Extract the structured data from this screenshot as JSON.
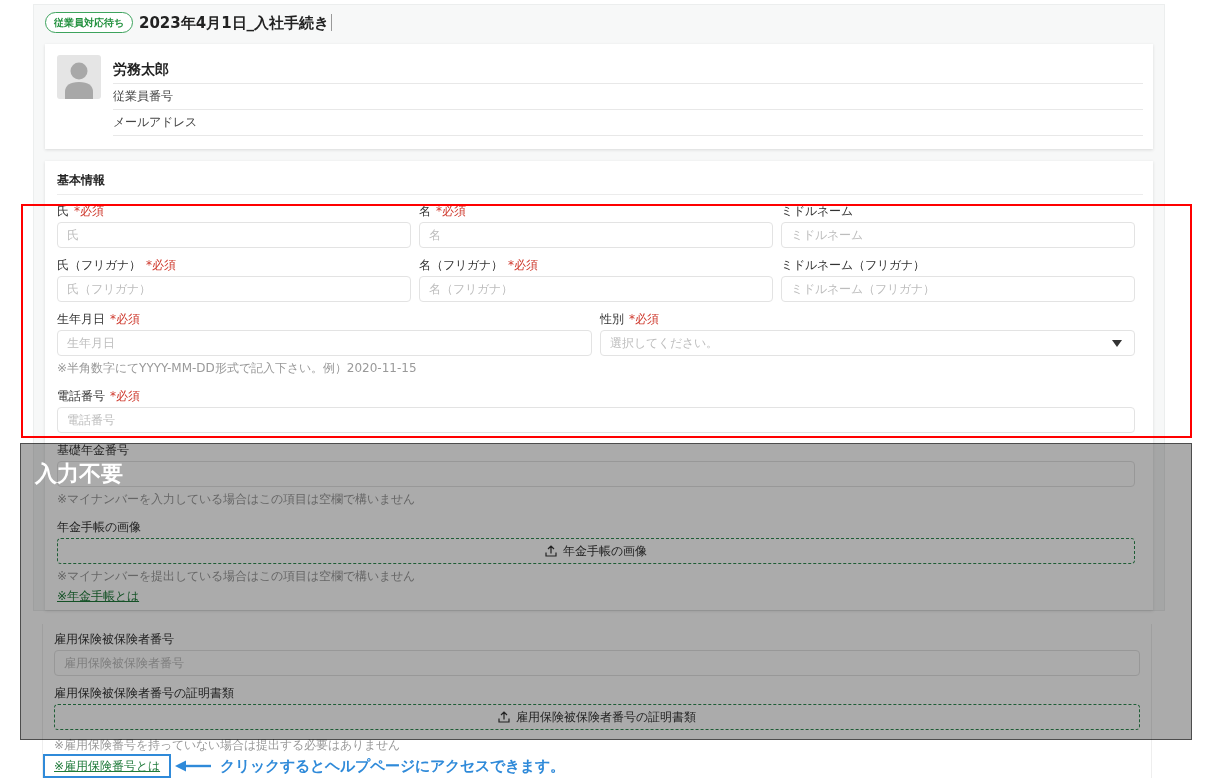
{
  "header": {
    "status_badge": "従業員対応待ち",
    "title": "2023年4月1日_入社手続き",
    "title_focused": true
  },
  "profile": {
    "name": "労務太郎",
    "fields": [
      "従業員番号",
      "メールアドレス"
    ]
  },
  "basic_info": {
    "title": "基本情報",
    "rows": [
      {
        "fields": [
          {
            "kind": "text",
            "label": "氏",
            "required_mark": "*必須",
            "placeholder": "氏"
          },
          {
            "kind": "text",
            "label": "名",
            "required_mark": "*必須",
            "placeholder": "名"
          },
          {
            "kind": "text",
            "label": "ミドルネーム",
            "placeholder": "ミドルネーム"
          }
        ]
      },
      {
        "fields": [
          {
            "kind": "text",
            "label": "氏（フリガナ）",
            "required_mark": "*必須",
            "placeholder": "氏（フリガナ）"
          },
          {
            "kind": "text",
            "label": "名（フリガナ）",
            "required_mark": "*必須",
            "placeholder": "名（フリガナ）"
          },
          {
            "kind": "text",
            "label": "ミドルネーム（フリガナ）",
            "placeholder": "ミドルネーム（フリガナ）"
          }
        ]
      },
      {
        "fields": [
          {
            "kind": "text",
            "label": "生年月日",
            "required_mark": "*必須",
            "placeholder": "生年月日",
            "hint": "※半角数字にてYYYY-MM-DD形式で記入下さい。例）2020-11-15"
          },
          {
            "kind": "select",
            "label": "性別",
            "required_mark": "*必須",
            "placeholder": "選択してください。"
          }
        ]
      },
      {
        "fields": [
          {
            "kind": "text",
            "label": "電話番号",
            "required_mark": "*必須",
            "placeholder": "電話番号"
          }
        ]
      },
      {
        "fields": [
          {
            "kind": "text",
            "label": "基礎年金番号",
            "hint": "※マイナンバーを入力している場合はこの項目は空欄で構いません"
          }
        ]
      },
      {
        "fields": [
          {
            "kind": "upload",
            "label": "年金手帳の画像",
            "button": "年金手帳の画像",
            "hint": "※マイナンバーを提出している場合はこの項目は空欄で構いません",
            "link": "※年金手帳とは"
          }
        ]
      }
    ]
  },
  "employment_insurance": {
    "rows": [
      {
        "fields": [
          {
            "kind": "text",
            "label": "雇用保険被保険者番号",
            "placeholder": "雇用保険被保険者番号"
          }
        ]
      },
      {
        "fields": [
          {
            "kind": "upload",
            "label": "雇用保険被保険者番号の証明書類",
            "button": "雇用保険被保険者番号の証明書類",
            "hint": "※雇用保険番号を持っていない場合は提出する必要はありません",
            "link": "※雇用保険番号とは"
          }
        ]
      }
    ]
  },
  "annotations": {
    "not_required_label": "入力不要",
    "help_callout": "クリックするとヘルプページにアクセスできます。"
  }
}
